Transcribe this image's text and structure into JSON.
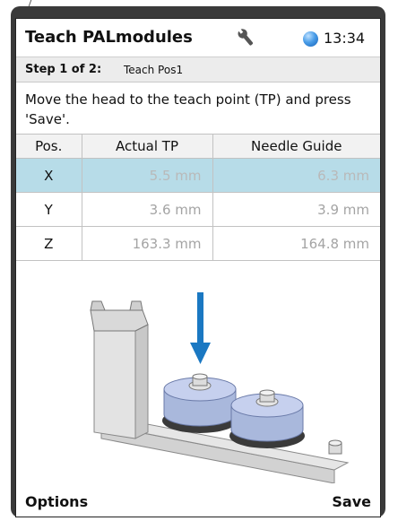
{
  "header": {
    "title": "Teach PALmodules",
    "time": "13:34"
  },
  "step": {
    "prefix": "Step 1 of 2:",
    "label": "Teach Pos1"
  },
  "instruction": "Move the head to the teach point (TP) and press 'Save'.",
  "table": {
    "columns": [
      "Pos.",
      "Actual TP",
      "Needle Guide"
    ],
    "rows": [
      {
        "pos": "X",
        "actual": "5.5 mm",
        "guide": "6.3 mm"
      },
      {
        "pos": "Y",
        "actual": "3.6 mm",
        "guide": "3.9 mm"
      },
      {
        "pos": "Z",
        "actual": "163.3 mm",
        "guide": "164.8 mm"
      }
    ],
    "selected_row": "X"
  },
  "softkeys": {
    "left": "Options",
    "right": "Save"
  },
  "colors": {
    "selected_row": "#b7dce8",
    "arrow": "#1a78c2",
    "status_dot": "#3a8ee0"
  },
  "icons": {
    "wrench": "wrench-icon",
    "status": "status-dot-icon",
    "arrow": "down-arrow-icon"
  }
}
